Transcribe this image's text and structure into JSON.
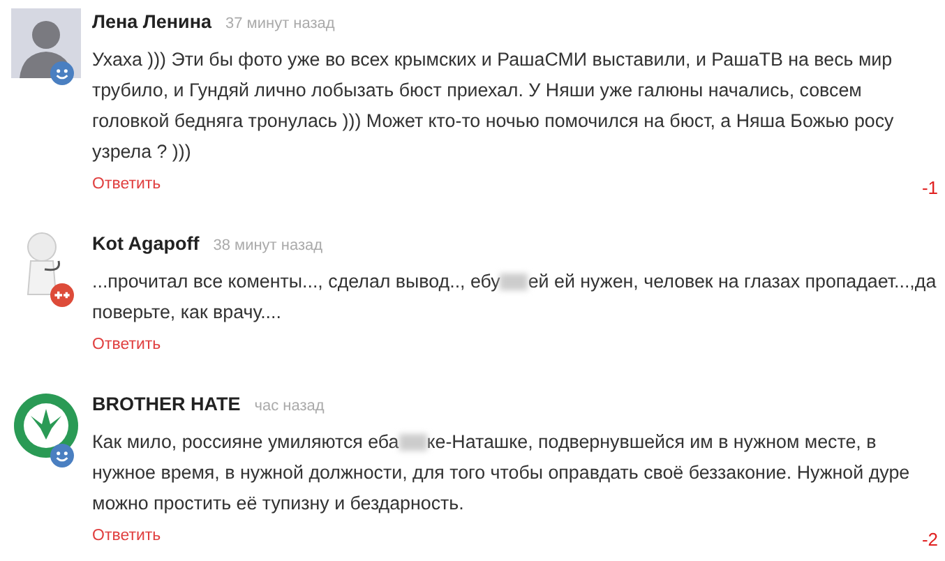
{
  "comments": [
    {
      "author": "Лена Ленина",
      "time": "37 минут назад",
      "avatar": {
        "kind": "silhouette"
      },
      "badge": {
        "kind": "smiley"
      },
      "body": [
        {
          "kind": "text",
          "text": "Ухаха ))) Эти бы фото уже во всех крымских и РашаСМИ выставили, и РашаТВ на весь мир трубило, и Гундяй лично лобызать бюст приехал. У Няши уже галюны начались, совсем головкой бедняга тронулась ))) Может кто-то ночью помочился на бюст, а  Няша Божью росу узрела ? )))"
        }
      ],
      "reply": "Ответить",
      "score": "-1"
    },
    {
      "author": "Kot Agapoff",
      "time": "38 минут назад",
      "avatar": {
        "kind": "figure"
      },
      "badge": {
        "kind": "gplus"
      },
      "body": [
        {
          "kind": "text",
          "text": "...прочитал все коменты..., сделал вывод.., ебу"
        },
        {
          "kind": "censored"
        },
        {
          "kind": "text",
          "text": "ей ей нужен, человек на глазах пропадает...,да поверьте, как врачу...."
        }
      ],
      "reply": "Ответить"
    },
    {
      "author": "BROTHER HATE",
      "time": "час назад",
      "avatar": {
        "kind": "stamp"
      },
      "badge": {
        "kind": "smiley"
      },
      "body": [
        {
          "kind": "text",
          "text": "Как мило, россияне умиляются еба"
        },
        {
          "kind": "censored"
        },
        {
          "kind": "text",
          "text": "ке-Наташке, подвернувшейся им в нужном месте, в нужное время, в нужной должности, для того чтобы оправдать своё беззаконие. Нужной дуре можно простить её тупизну и бездарность."
        }
      ],
      "reply": "Ответить",
      "score": "-2"
    }
  ]
}
